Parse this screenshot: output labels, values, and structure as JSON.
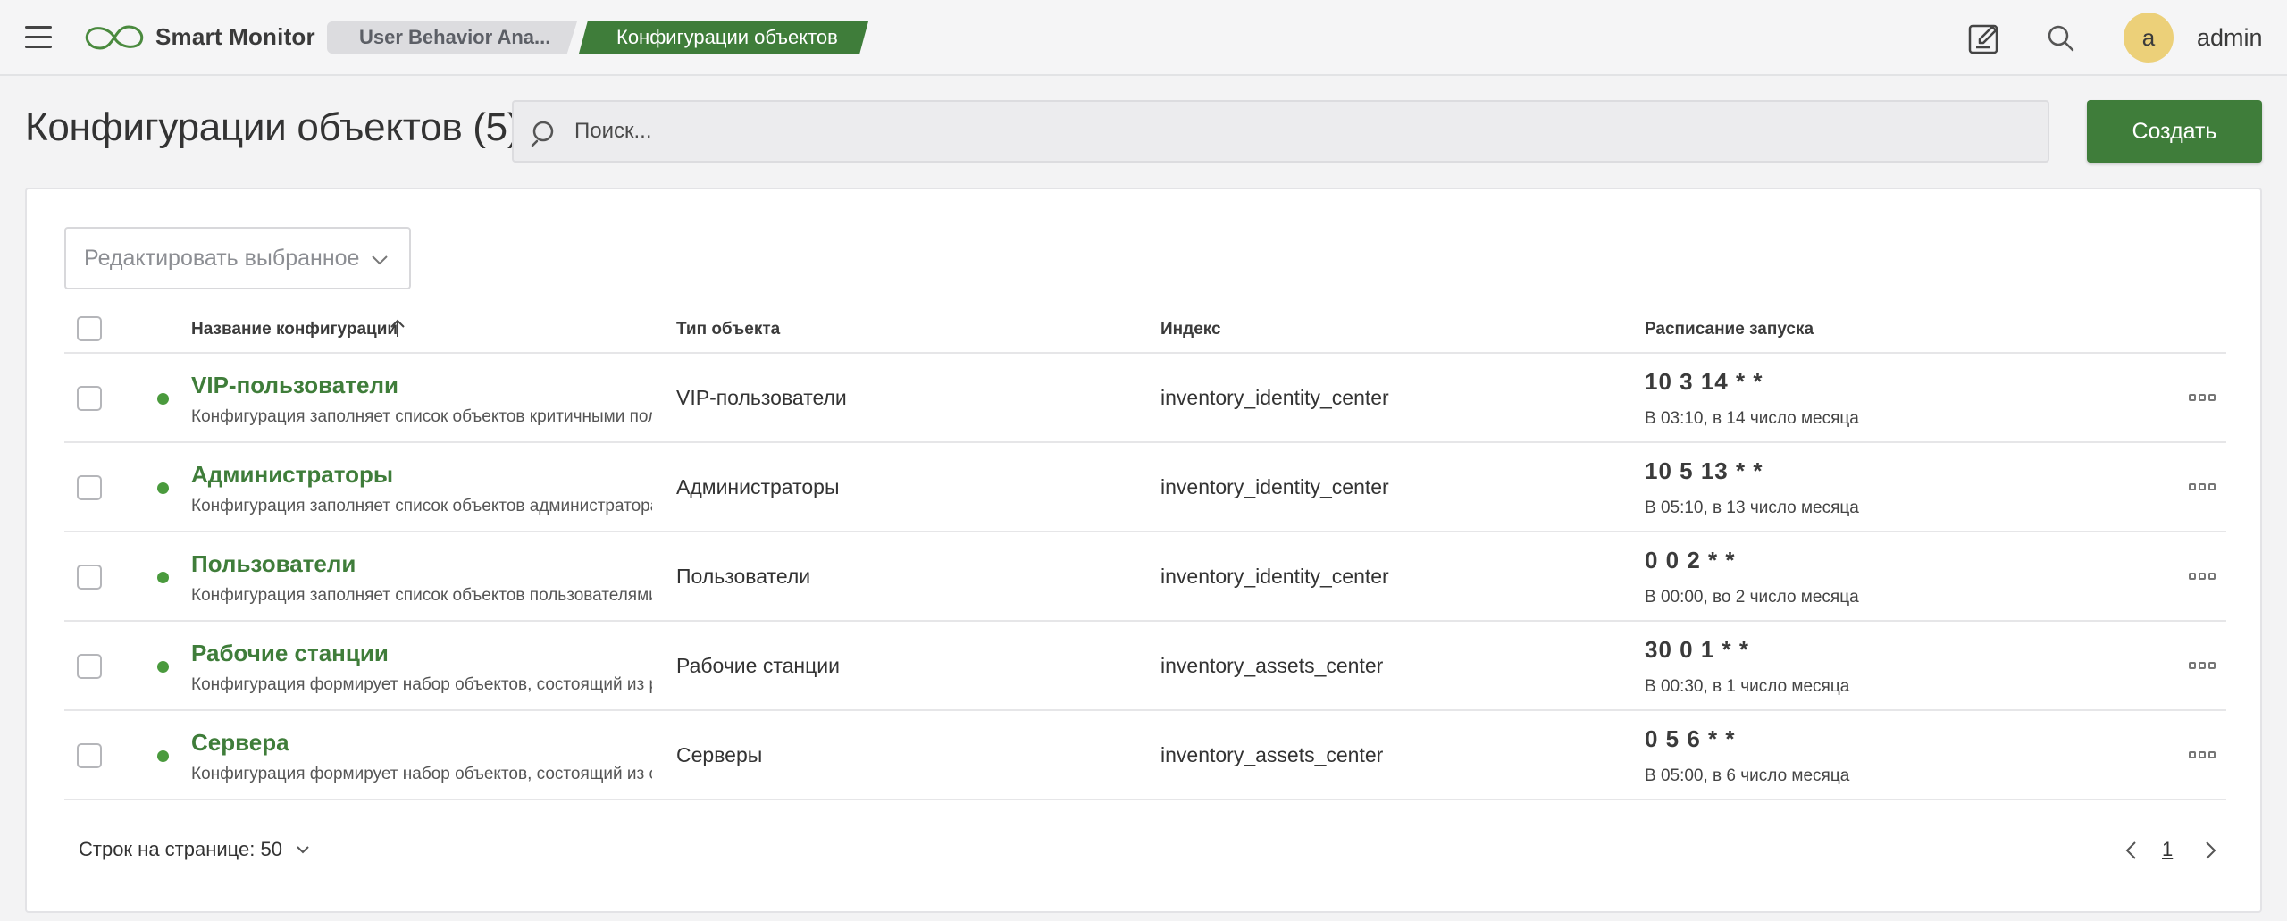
{
  "header": {
    "brand": "Smart Monitor",
    "breadcrumbs": [
      {
        "label": "User Behavior Ana..."
      },
      {
        "label": "Конфигурации объектов"
      }
    ],
    "user": {
      "initial": "a",
      "name": "admin"
    },
    "icons": {
      "menu": "menu-icon",
      "logo": "infinity-logo-icon",
      "edit": "edit-icon",
      "search": "search-icon"
    },
    "colors": {
      "accent": "#3f7d3a",
      "avatar": "#ecd079"
    }
  },
  "page": {
    "title": "Конфигурации объектов (5)",
    "search_placeholder": "Поиск...",
    "create_label": "Создать"
  },
  "table": {
    "bulk_edit_label": "Редактировать выбранное",
    "columns": {
      "name": "Название конфигурации",
      "type": "Тип объекта",
      "index": "Индекс",
      "schedule": "Расписание запуска"
    },
    "sort": {
      "column": "name",
      "direction": "asc"
    },
    "rows": [
      {
        "name": "VIP-пользователи",
        "description": "Конфигурация заполняет список объектов критичными пользователями",
        "type": "VIP-пользователи",
        "index": "inventory_identity_center",
        "cron": "10 3 14 * *",
        "cron_desc": "В 03:10, в 14 число месяца",
        "status": "active"
      },
      {
        "name": "Администраторы",
        "description": "Конфигурация заполняет список объектов администраторами",
        "type": "Администраторы",
        "index": "inventory_identity_center",
        "cron": "10 5 13 * *",
        "cron_desc": "В 05:10, в 13 число месяца",
        "status": "active"
      },
      {
        "name": "Пользователи",
        "description": "Конфигурация заполняет список объектов пользователями, ",
        "type": "Пользователи",
        "index": "inventory_identity_center",
        "cron": "0 0 2 * *",
        "cron_desc": "В 00:00, во 2 число месяца",
        "status": "active"
      },
      {
        "name": "Рабочие станции",
        "description": "Конфигурация формирует набор объектов, состоящий из рабочих станций",
        "type": "Рабочие станции",
        "index": "inventory_assets_center",
        "cron": "30 0 1 * *",
        "cron_desc": "В 00:30, в 1 число месяца",
        "status": "active"
      },
      {
        "name": "Сервера",
        "description": "Конфигурация формирует набор объектов, состоящий из серверов",
        "type": "Серверы",
        "index": "inventory_assets_center",
        "cron": "0 5 6 * *",
        "cron_desc": "В 05:00, в 6 число месяца",
        "status": "active"
      }
    ]
  },
  "footer": {
    "rows_per_page_label": "Строк на странице: 50",
    "current_page": "1"
  }
}
